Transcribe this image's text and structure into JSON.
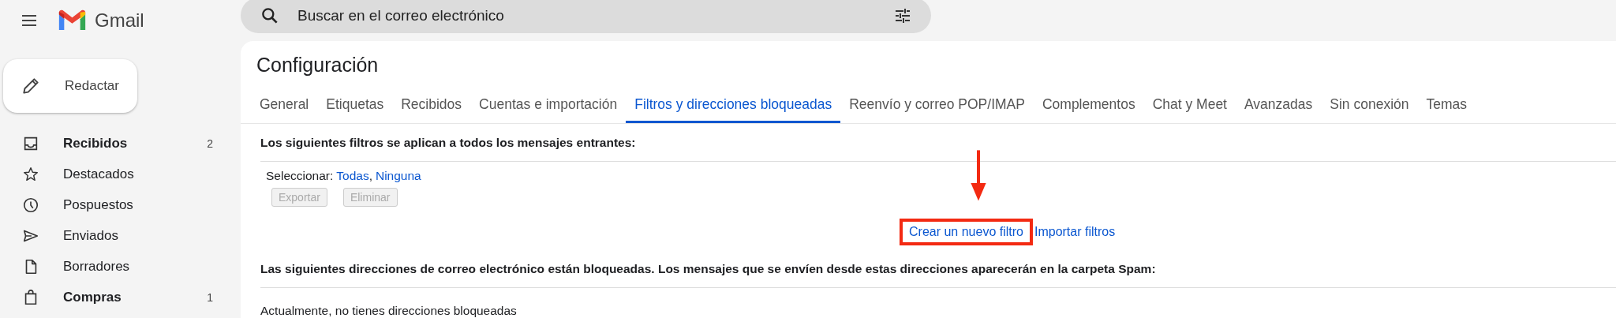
{
  "header": {
    "app_name": "Gmail",
    "search": {
      "placeholder": "Buscar en el correo electrónico"
    }
  },
  "compose": {
    "label": "Redactar"
  },
  "sidebar": {
    "items": [
      {
        "kind": "inbox",
        "label": "Recibidos",
        "count": "2",
        "bold": true
      },
      {
        "kind": "star",
        "label": "Destacados",
        "bold": false
      },
      {
        "kind": "clock",
        "label": "Pospuestos",
        "bold": false
      },
      {
        "kind": "send",
        "label": "Enviados",
        "bold": false
      },
      {
        "kind": "file",
        "label": "Borradores",
        "bold": false
      },
      {
        "kind": "bag",
        "label": "Compras",
        "count": "1",
        "bold": true
      }
    ]
  },
  "settings": {
    "title": "Configuración",
    "tabs": [
      {
        "label": "General",
        "selected": false
      },
      {
        "label": "Etiquetas",
        "selected": false
      },
      {
        "label": "Recibidos",
        "selected": false
      },
      {
        "label": "Cuentas e importación",
        "selected": false
      },
      {
        "label": "Filtros y direcciones bloqueadas",
        "selected": true
      },
      {
        "label": "Reenvío y correo POP/IMAP",
        "selected": false
      },
      {
        "label": "Complementos",
        "selected": false
      },
      {
        "label": "Chat y Meet",
        "selected": false
      },
      {
        "label": "Avanzadas",
        "selected": false
      },
      {
        "label": "Sin conexión",
        "selected": false
      },
      {
        "label": "Temas",
        "selected": false
      }
    ],
    "filters": {
      "heading": "Los siguientes filtros se aplican a todos los mensajes entrantes:",
      "select_label": "Seleccionar:",
      "select_links": [
        "Todas",
        "Ninguna"
      ],
      "separator": ",",
      "buttons": [
        {
          "label": "Exportar",
          "disabled": true
        },
        {
          "label": "Eliminar",
          "disabled": true
        }
      ],
      "actions": [
        {
          "label": "Crear un nuevo filtro",
          "highlighted": true
        },
        {
          "label": "Importar filtros",
          "highlighted": false
        }
      ]
    },
    "blocked": {
      "heading": "Las siguientes direcciones de correo electrónico están bloqueadas. Los mensajes que se envíen desde estas direcciones aparecerán en la carpeta Spam:",
      "empty_text": "Actualmente, no tienes direcciones bloqueadas"
    }
  }
}
